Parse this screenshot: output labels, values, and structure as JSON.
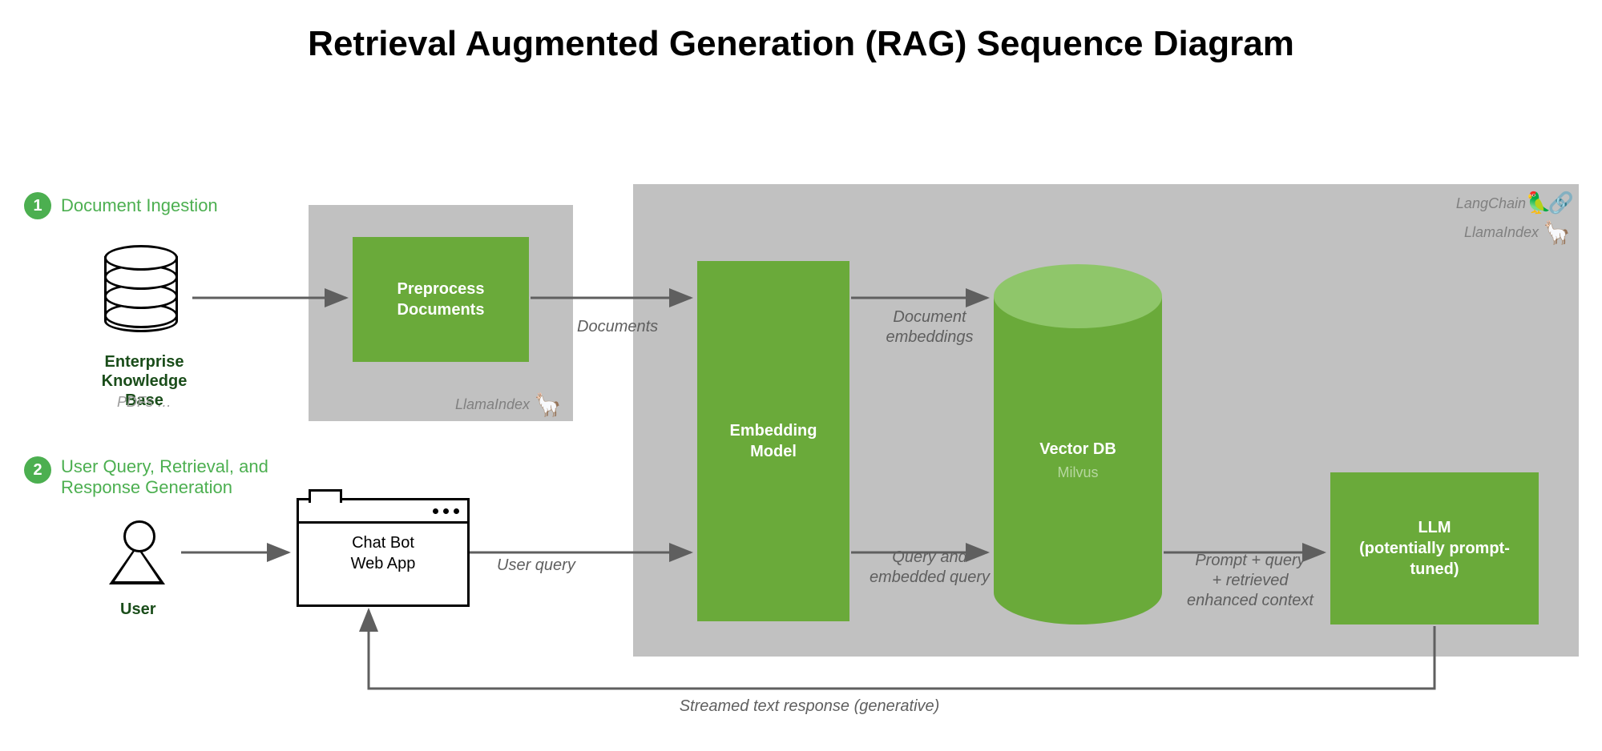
{
  "title": "Retrieval Augmented Generation (RAG) Sequence Diagram",
  "steps": {
    "one": {
      "num": "1",
      "label": "Document Ingestion"
    },
    "two": {
      "num": "2",
      "label": "User Query, Retrieval, and\nResponse Generation"
    }
  },
  "knowledge_base": {
    "line1": "Enterprise",
    "line2": "Knowledge Base",
    "sub": "PDFs …"
  },
  "preprocess": {
    "line1": "Preprocess",
    "line2": "Documents"
  },
  "embedding": {
    "line1": "Embedding",
    "line2": "Model"
  },
  "vectordb": {
    "label": "Vector DB",
    "sub": "Milvus"
  },
  "llm": {
    "line1": "LLM",
    "line2": "(potentially prompt-",
    "line3": "tuned)"
  },
  "chatbot": {
    "line1": "Chat Bot",
    "line2": "Web App"
  },
  "user_label": "User",
  "arrows": {
    "documents": "Documents",
    "doc_embed_l1": "Document",
    "doc_embed_l2": "embeddings",
    "user_query": "User query",
    "query_embed_l1": "Query and",
    "query_embed_l2": "embedded query",
    "prompt_l1": "Prompt + query",
    "prompt_l2": "+ retrieved",
    "prompt_l3": "enhanced context",
    "stream": "Streamed text response (generative)"
  },
  "notes": {
    "langchain": "LangChain",
    "llamaindex": "LlamaIndex",
    "llamaindex_small": "LlamaIndex"
  }
}
